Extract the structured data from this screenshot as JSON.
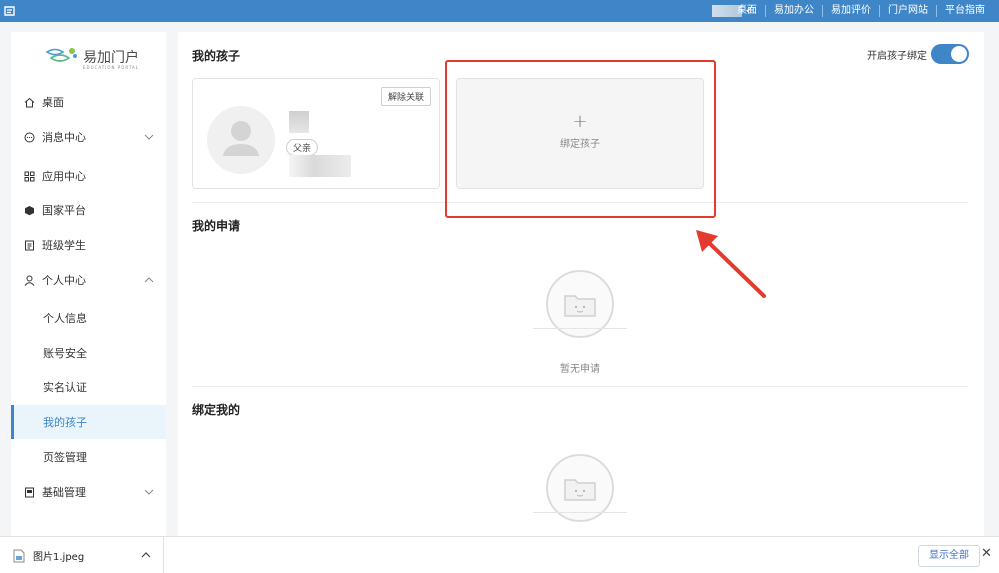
{
  "topbar": {
    "app_icon": "app-return-icon",
    "check": "✓",
    "links": [
      "桌面",
      "易加办公",
      "易加评价",
      "门户网站",
      "平台指南"
    ]
  },
  "brand": {
    "name": "易加门户",
    "subtitle": "EDUCATION PORTAL"
  },
  "sidebar": {
    "items": [
      {
        "label": "桌面",
        "icon": "home-icon"
      },
      {
        "label": "消息中心",
        "icon": "message-icon",
        "chevron": "down"
      },
      {
        "label": "应用中心",
        "icon": "apps-grid-icon"
      },
      {
        "label": "国家平台",
        "icon": "cube-icon"
      },
      {
        "label": "班级学生",
        "icon": "class-book-icon"
      },
      {
        "label": "个人中心",
        "icon": "user-icon",
        "chevron": "up"
      },
      {
        "label": "基础管理",
        "icon": "base-manage-icon",
        "chevron": "down"
      }
    ],
    "sub_items": [
      "个人信息",
      "账号安全",
      "实名认证",
      "我的孩子",
      "页签管理"
    ],
    "active_sub": "我的孩子"
  },
  "main": {
    "my_children_title": "我的孩子",
    "toggle_label": "开启孩子绑定",
    "toggle_on": true,
    "child": {
      "relation_tag": "父亲",
      "unlink_label": "解除关联"
    },
    "bind_card": {
      "plus": "+",
      "label": "绑定孩子"
    },
    "my_applications_title": "我的申请",
    "empty_label": "暂无申请",
    "bound_me_title": "绑定我的"
  },
  "download_bar": {
    "file_name": "图片1.jpeg",
    "show_all": "显示全部",
    "close": "✕"
  },
  "colors": {
    "accent": "#3f86c9",
    "annotation": "#e53a2e"
  }
}
